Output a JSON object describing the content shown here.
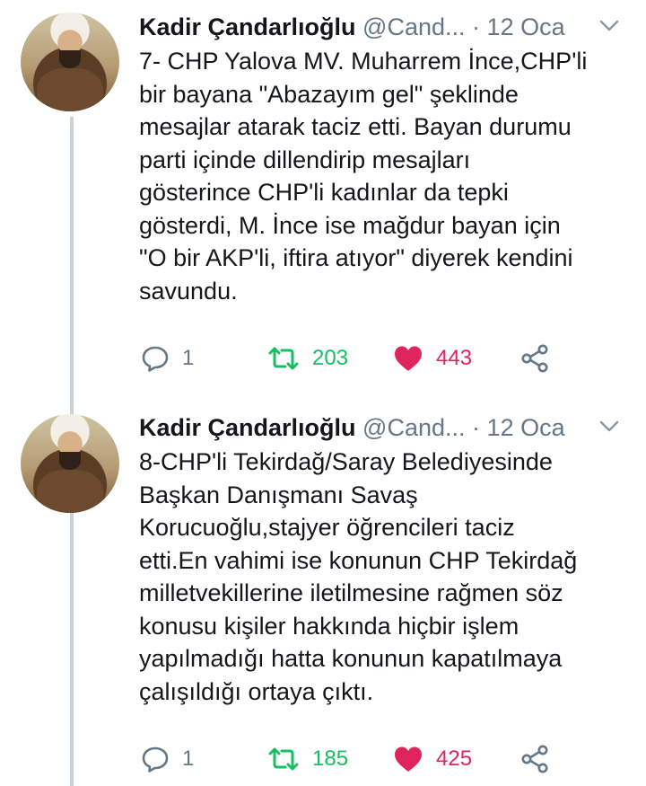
{
  "tweets": [
    {
      "author_name": "Kadir Çandarlıoğlu",
      "handle": "@Cand...",
      "separator": "·",
      "time": "12 Oca",
      "lines": [
        "7- CHP Yalova MV. Muharrem İnce,CHP'li",
        "bir bayana \"Abazayım gel\" şeklinde",
        "mesajlar atarak taciz etti. Bayan durumu",
        "parti içinde dillendirip mesajları",
        "gösterince CHP'li kadınlar da tepki",
        "gösterdi, M. İnce ise mağdur bayan için",
        "\"O bir AKP'li, iftira atıyor\" diyerek kendini",
        "savundu."
      ],
      "replies": "1",
      "retweets": "203",
      "likes": "443"
    },
    {
      "author_name": "Kadir Çandarlıoğlu",
      "handle": "@Cand...",
      "separator": "·",
      "time": "12 Oca",
      "lines": [
        "8-CHP'li Tekirdağ/Saray Belediyesinde",
        "Başkan Danışmanı Savaş",
        "Korucuoğlu,stajyer öğrencileri taciz",
        "etti.En vahimi ise konunun CHP Tekirdağ",
        "milletvekillerine iletilmesine rağmen söz",
        "konusu kişiler hakkında hiçbir işlem",
        "yapılmadığı hatta konunun kapatılmaya",
        "çalışıldığı ortaya çıktı."
      ],
      "replies": "1",
      "retweets": "185",
      "likes": "425"
    }
  ],
  "icons": {
    "reply": "reply-icon",
    "retweet": "retweet-icon",
    "like": "heart-icon",
    "share": "share-icon",
    "menu": "chevron-down-icon"
  },
  "colors": {
    "retweet": "#17bf63",
    "like": "#e0245e",
    "muted": "#657786",
    "thread_line": "#c8d2da"
  }
}
